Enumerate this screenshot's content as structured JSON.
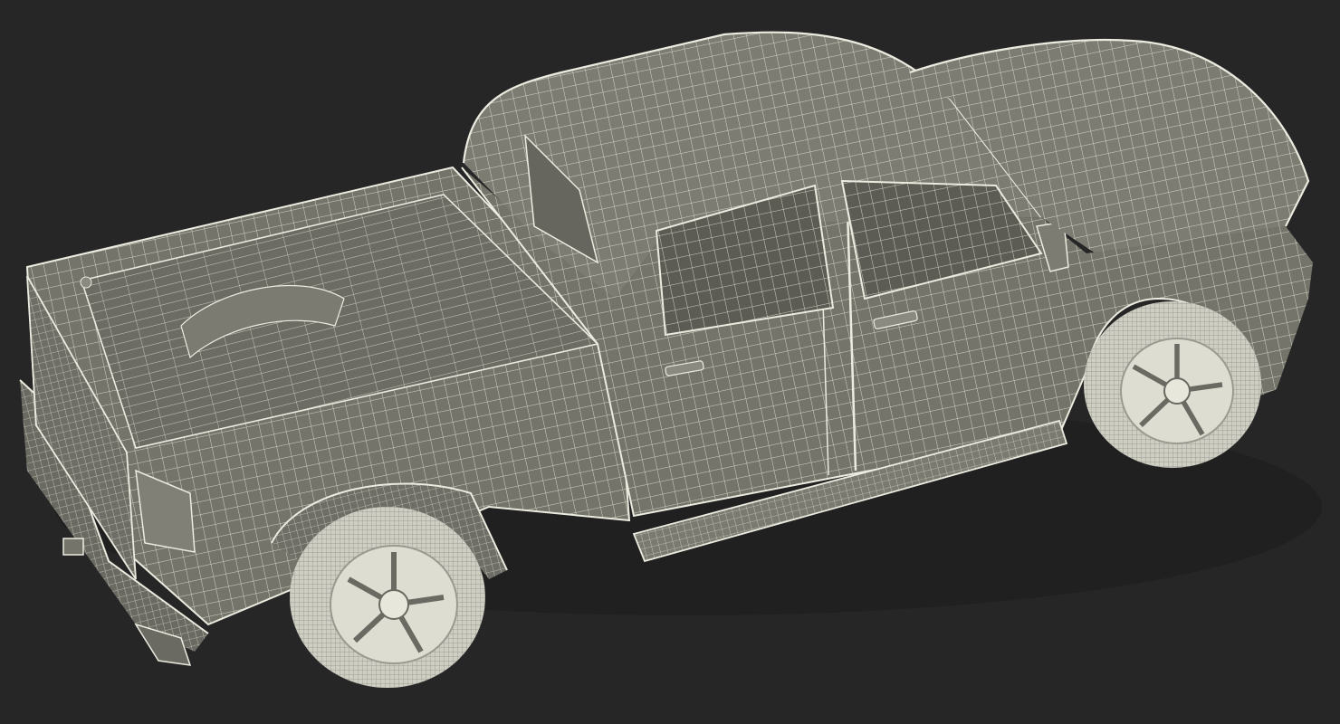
{
  "scene": {
    "subject": "pickup-truck-wireframe-render",
    "colors": {
      "background": "#262626",
      "surface": "#74746a",
      "surface_light": "#8a8a80",
      "surface_dark": "#5c5c54",
      "wire": "#ecebe0",
      "tire": "#d8d7cc"
    }
  }
}
